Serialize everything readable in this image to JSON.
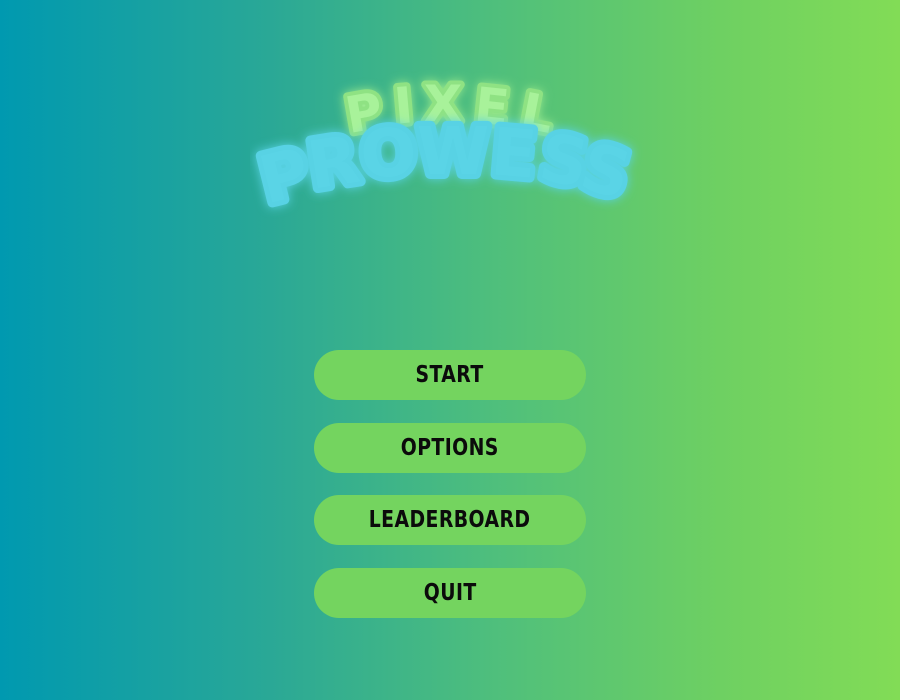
{
  "game": {
    "logo": {
      "line1": "PIXEL",
      "line2": "PROWESS",
      "line1_letters": [
        "P",
        "I",
        "X",
        "E",
        "L"
      ],
      "line2_letters": [
        "P",
        "R",
        "O",
        "W",
        "E",
        "S",
        "S"
      ]
    },
    "menu": {
      "items": [
        {
          "label": "START"
        },
        {
          "label": "OPTIONS"
        },
        {
          "label": "LEADERBOARD"
        },
        {
          "label": "QUIT"
        }
      ]
    }
  },
  "colors": {
    "background_left": "#0099b0",
    "background_right": "#82dc56",
    "button_fill": "#74d45f",
    "button_text": "#0b0b0b",
    "logo_line1": "#a8f29a",
    "logo_line2": "#5ad4e6"
  }
}
